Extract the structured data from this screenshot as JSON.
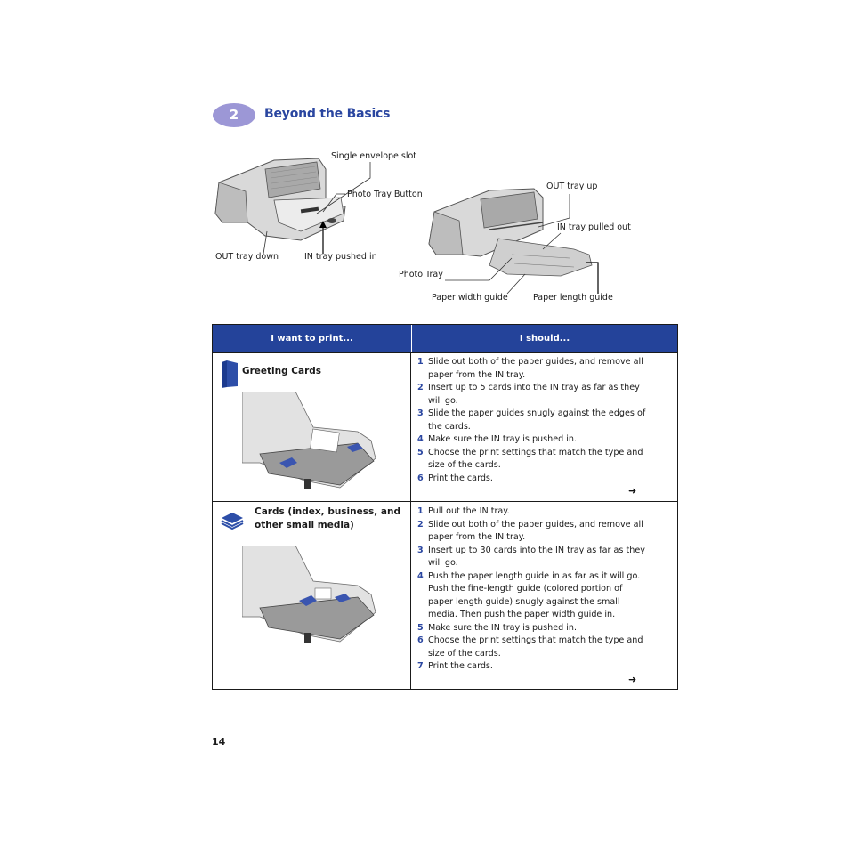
{
  "chapter": {
    "number": "2",
    "title": "Beyond the Basics",
    "badge_color": "#9c97d6",
    "title_color": "#2a46a0"
  },
  "figure_left": {
    "callouts": {
      "envelope_slot": "Single envelope slot",
      "photo_tray_button": "Photo Tray Button",
      "out_tray_down": "OUT tray down",
      "in_tray_pushed_in": "IN tray pushed in"
    }
  },
  "figure_right": {
    "callouts": {
      "out_tray_up": "OUT tray up",
      "in_tray_pulled_out": "IN tray pulled out",
      "photo_tray": "Photo Tray",
      "paper_width_guide": "Paper width guide",
      "paper_length_guide": "Paper length guide"
    }
  },
  "table": {
    "header_color": "#24439a",
    "headers": [
      "I want to print...",
      "I should..."
    ],
    "rows": [
      {
        "icon": "greeting-card-icon",
        "title": "Greeting Cards",
        "steps": [
          {
            "n": "1",
            "text": "Slide out both of the paper guides, and remove all paper from the IN tray."
          },
          {
            "n": "2",
            "text": "Insert up to 5 cards into the IN tray as far as they will go."
          },
          {
            "n": "3",
            "text": "Slide the paper guides snugly against the edges of the cards."
          },
          {
            "n": "4",
            "text": "Make sure the IN tray is pushed in."
          },
          {
            "n": "5",
            "text": "Choose the print settings that match the type and size of the cards."
          },
          {
            "n": "6",
            "text": "Print the cards."
          }
        ],
        "continue_arrow": "➜"
      },
      {
        "icon": "card-stack-icon",
        "title_line1": "Cards (index, business, and",
        "title_line2": "other small media)",
        "steps": [
          {
            "n": "1",
            "text": "Pull out the IN tray."
          },
          {
            "n": "2",
            "text": "Slide out both of the paper guides, and remove all paper from the IN tray."
          },
          {
            "n": "3",
            "text": "Insert up to 30 cards into the IN tray as far as they will go."
          },
          {
            "n": "4",
            "text": "Push the paper length guide in as far as it will go. Push the fine-length guide (colored portion of paper length guide) snugly against the small media. Then push the paper width guide in."
          },
          {
            "n": "5",
            "text": "Make sure the IN tray is pushed in."
          },
          {
            "n": "6",
            "text": "Choose the print settings that match the type and size of the cards."
          },
          {
            "n": "7",
            "text": "Print the cards."
          }
        ],
        "continue_arrow": "➜"
      }
    ]
  },
  "page_number": "14"
}
